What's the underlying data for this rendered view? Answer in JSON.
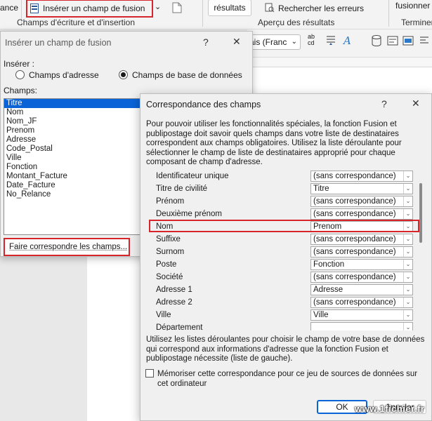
{
  "ribbon": {
    "left_cut": "ance",
    "insert_merge_field": "Insérer un champ de fusion",
    "insert_dropdown_glyph": "⌄",
    "results_btn": "résultats",
    "find_errors": "Rechercher les erreurs",
    "finish_cut": "fusionner",
    "group_fields": "Champs d'écriture et d'insertion",
    "group_preview": "Aperçu des résultats",
    "group_finish": "Terminer"
  },
  "doc_toolbar": {
    "font_box": "ais (Franc",
    "font_arrow": "⌄",
    "abc_label": "ab\ncd"
  },
  "insert_dialog": {
    "title": "Insérer un champ de fusion",
    "help": "?",
    "close": "✕",
    "insert_label": "Insérer :",
    "radio_address": "Champs d'adresse",
    "radio_db": "Champs de base de données",
    "fields_label": "Champs:",
    "fields": [
      "Titre",
      "Nom",
      "Nom_JF",
      "Prenom",
      "Adresse",
      "Code_Postal",
      "Ville",
      "Fonction",
      "Montant_Facture",
      "Date_Facture",
      "No_Relance"
    ],
    "selected_index": 0,
    "match_button": "Faire correspondre les champs..."
  },
  "match_dialog": {
    "title": "Correspondance des champs",
    "help": "?",
    "close": "✕",
    "intro": "Pour pouvoir utiliser les fonctionnalités spéciales, la fonction Fusion et publipostage doit savoir quels champs dans votre liste de destinataires correspondent aux champs obligatoires. Utilisez la liste déroulante pour sélectionner le champ de liste de destinataires approprié pour chaque composant de champ d'adresse.",
    "rows": [
      {
        "label": "Identificateur unique",
        "value": "(sans correspondance)"
      },
      {
        "label": "Titre de civilité",
        "value": "Titre"
      },
      {
        "label": "Prénom",
        "value": "(sans correspondance)"
      },
      {
        "label": "Deuxième prénom",
        "value": "(sans correspondance)"
      },
      {
        "label": "Nom",
        "value": "Prenom"
      },
      {
        "label": "Suffixe",
        "value": "(sans correspondance)"
      },
      {
        "label": "Surnom",
        "value": "(sans correspondance)"
      },
      {
        "label": "Poste",
        "value": "Fonction"
      },
      {
        "label": "Société",
        "value": "(sans correspondance)"
      },
      {
        "label": "Adresse 1",
        "value": "Adresse"
      },
      {
        "label": "Adresse 2",
        "value": "(sans correspondance)"
      },
      {
        "label": "Ville",
        "value": "Ville"
      },
      {
        "label": "Département",
        "value": ""
      }
    ],
    "highlighted_row": 4,
    "bottom_text": "Utilisez les listes déroulantes pour choisir le champ de votre base de données qui correspond aux informations d'adresse que la fonction Fusion et publipostage nécessite (liste de gauche).",
    "remember_label": "Mémoriser cette correspondance pour ce jeu de sources de données sur cet ordinateur",
    "remember_checked": false,
    "ok": "OK",
    "cancel": "Annuler"
  },
  "watermark": "www.1fichier.fr"
}
